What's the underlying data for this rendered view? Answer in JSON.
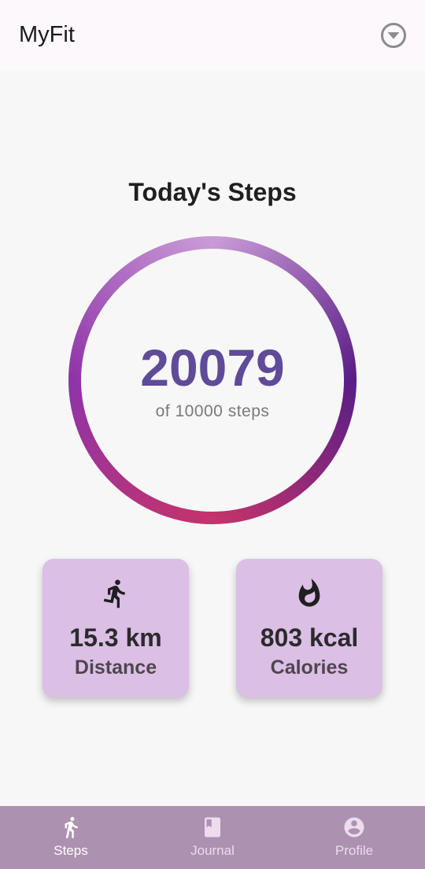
{
  "app_bar": {
    "title": "MyFit",
    "menu_icon": "dropdown-circle-icon"
  },
  "main": {
    "heading": "Today's Steps",
    "steps": {
      "value": "20079",
      "goal_text": "of 10000 steps",
      "progress_fraction": 1.0
    },
    "ring_colors": {
      "top": "#c99bd6",
      "right": "#5a1e86",
      "bottom": "#c4336b",
      "left": "#9d45b0"
    },
    "stats": [
      {
        "icon": "running-icon",
        "value": "15.3 km",
        "label": "Distance"
      },
      {
        "icon": "flame-icon",
        "value": "803 kcal",
        "label": "Calories"
      }
    ]
  },
  "bottom_nav": {
    "items": [
      {
        "label": "Steps",
        "icon": "walking-icon",
        "active": true
      },
      {
        "label": "Journal",
        "icon": "book-icon",
        "active": false
      },
      {
        "label": "Profile",
        "icon": "account-circle-icon",
        "active": false
      }
    ]
  },
  "colors": {
    "card_bg": "#dbbfe5",
    "nav_bg": "#ad91b1",
    "steps_value": "#5f4b98"
  }
}
